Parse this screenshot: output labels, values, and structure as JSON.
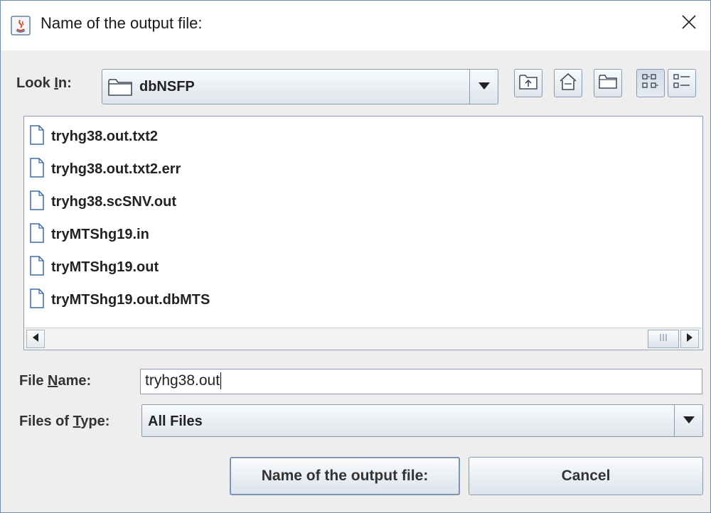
{
  "window": {
    "title": "Name of the output file:",
    "close_icon": "close-icon"
  },
  "look_in": {
    "label_pre": "Look ",
    "label_mnemonic": "I",
    "label_post": "n:",
    "value": "dbNSFP",
    "folder_icon": "folder-icon"
  },
  "toolbar": {
    "buttons": [
      {
        "name": "up-one-level-button",
        "icon": "up-folder-icon",
        "pressed": false
      },
      {
        "name": "home-button",
        "icon": "home-icon",
        "pressed": false
      },
      {
        "name": "new-folder-button",
        "icon": "new-folder-icon",
        "pressed": false
      },
      {
        "name": "list-view-button",
        "icon": "list-view-icon",
        "pressed": true
      },
      {
        "name": "details-view-button",
        "icon": "details-view-icon",
        "pressed": false
      }
    ]
  },
  "files": [
    {
      "name": "tryhg38.out.txt2"
    },
    {
      "name": "tryhg38.out.txt2.err"
    },
    {
      "name": "tryhg38.scSNV.out"
    },
    {
      "name": "tryMTShg19.in"
    },
    {
      "name": "tryMTShg19.out"
    },
    {
      "name": "tryMTShg19.out.dbMTS"
    }
  ],
  "file_name": {
    "label_pre": "File ",
    "label_mnemonic": "N",
    "label_post": "ame:",
    "value": "tryhg38.out"
  },
  "file_type": {
    "label_pre": "Files of ",
    "label_mnemonic": "T",
    "label_post": "ype:",
    "value": "All Files"
  },
  "buttons": {
    "approve": "Name of the output file:",
    "cancel": "Cancel"
  },
  "colors": {
    "accent_border": "#8a9bb0",
    "window_bg": "#eeeeee"
  }
}
